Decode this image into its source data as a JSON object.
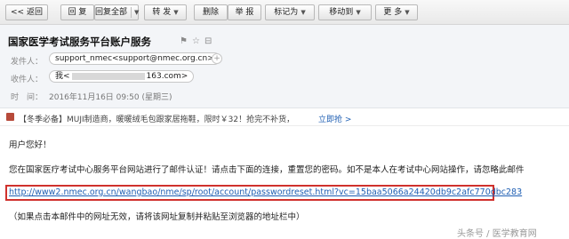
{
  "toolbar": {
    "back": "<< 返回",
    "reply": "回 复",
    "reply_all": "回复全部",
    "forward": "转 发",
    "delete": "删除",
    "report": "举 报",
    "mark_as": "标记为",
    "move_to": "移动到",
    "more": "更 多"
  },
  "mail": {
    "subject": "国家医学考试服务平台账户服务",
    "sender_label": "发件人：",
    "sender": "support_nmec<support@nmec.org.cn>",
    "recipient_label": "收件人：",
    "recipient_prefix": "我<",
    "recipient_suffix": "163.com>",
    "time_label": "时　间：",
    "time": "2016年11月16日 09:50 (星期三)"
  },
  "ad": {
    "text": "【冬季必备】MUJI制造商，暖暖绒毛包跟家居拖鞋，限时￥32！抢完不补货，",
    "link": "立即抢 >"
  },
  "body": {
    "greeting": "用户您好！",
    "line1": "您在国家医疗考试中心服务平台网站进行了邮件认证！请点击下面的连接，重置您的密码。如不是本人在考试中心网站操作，请忽略此邮件",
    "url": "http://www2.nmec.org.cn/wangbao/nme/sp/root/account/passwordreset.html?vc=15baa5066a24420db9c2afc770dbc283",
    "note": "（如果点击本邮件中的网址无效，请将该网址复制并粘贴至浏览器的地址栏中）"
  },
  "watermark": "头条号 / 医学教育网"
}
